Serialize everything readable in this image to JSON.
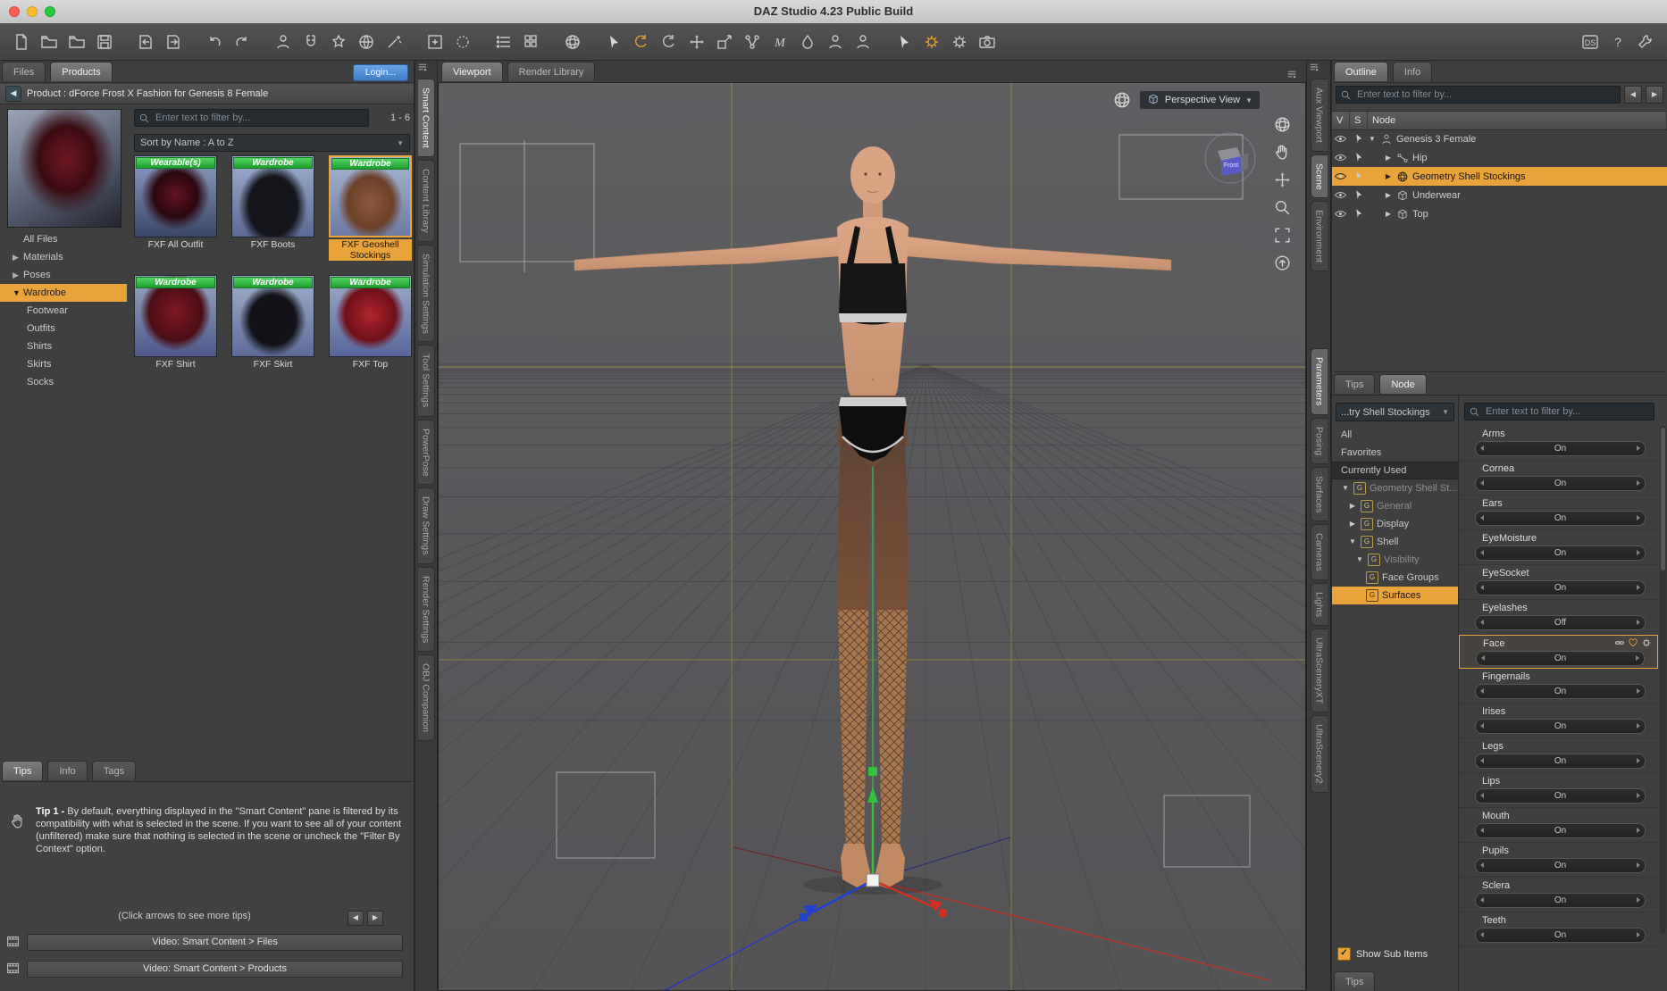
{
  "window": {
    "title": "DAZ Studio 4.23 Public Build"
  },
  "colors": {
    "accent_orange": "#E8A33B",
    "badge_green": "#2FB441",
    "login_blue": "#4D8FD6",
    "guide_yellow": "#B5A52A",
    "axis_red": "#C03028",
    "axis_green": "#35C040",
    "axis_blue": "#2840C8"
  },
  "toolbar": {
    "icons": [
      "new-file",
      "open-file",
      "merge-file",
      "save-file",
      "import",
      "export",
      "undo",
      "redo",
      "create-new-node",
      "magnet-snap",
      "align-tool",
      "perspective-gizmo",
      "magic-wand",
      "add-plane",
      "selection-marquee",
      "list-view",
      "thumbnail-grid-view",
      "iray-preview-sphere",
      "node-selection-tool",
      "rotate-tool",
      "orbit-tool",
      "translate-tool",
      "scale-tool",
      "node-connector-tool",
      "weight-map-tool",
      "geometry-editor-tool",
      "figure-transform-tool",
      "figure-setup-tool",
      "pointer-add-tool",
      "render-settings",
      "preferences",
      "spot-render-camera",
      "daz-store",
      "help",
      "customize"
    ]
  },
  "smart_content": {
    "tabs": {
      "files": "Files",
      "products": "Products"
    },
    "login": "Login...",
    "breadcrumb": "Product : dForce Frost X Fashion for Genesis 8 Female",
    "filter_placeholder": "Enter text to filter by...",
    "range": "1 - 6",
    "sort": "Sort by Name : A to Z",
    "categories": {
      "all_files": "All Files",
      "materials": "Materials",
      "poses": "Poses",
      "wardrobe": "Wardrobe",
      "footwear": "Footwear",
      "outfits": "Outfits",
      "shirts": "Shirts",
      "skirts": "Skirts",
      "socks": "Socks"
    },
    "products": [
      {
        "badge": "Wearable(s)",
        "name": "FXF All Outfit"
      },
      {
        "badge": "Wardrobe",
        "name": "FXF Boots"
      },
      {
        "badge": "Wardrobe",
        "name": "FXF Geoshell Stockings"
      },
      {
        "badge": "Wardrobe",
        "name": "FXF Shirt"
      },
      {
        "badge": "Wardrobe",
        "name": "FXF Skirt"
      },
      {
        "badge": "Wardrobe",
        "name": "FXF Top"
      }
    ],
    "tips": {
      "tabs": {
        "tips": "Tips",
        "info": "Info",
        "tags": "Tags"
      },
      "tip_label": "Tip 1 -",
      "tip_text": " By default, everything displayed in the \"Smart Content\" pane is filtered by its compatibility with what is selected in the scene. If you want to see all of your content (unfiltered) make sure that nothing is selected in the scene or uncheck the \"Filter By Context\" option.",
      "nav_hint": "(Click arrows to see more tips)",
      "video_files": "Video: Smart Content > Files",
      "video_products": "Video: Smart Content > Products"
    }
  },
  "left_tabs": [
    "Smart Content",
    "Content Library",
    "Simulation Settings",
    "Tool Settings",
    "PowerPose",
    "Draw Settings",
    "Render Settings",
    "OBJ Companion"
  ],
  "viewport": {
    "tab_viewport": "Viewport",
    "tab_render_library": "Render Library",
    "camera": "Perspective View",
    "cube_label": "Front",
    "side_tools": [
      "lighting-sphere",
      "pan-hand",
      "dolly-move",
      "zoom-magnifier",
      "aspect-frame",
      "reset-view"
    ]
  },
  "right_tabs": {
    "aux": "Aux Viewport",
    "scene": "Scene",
    "environment": "Environment",
    "parameters": "Parameters",
    "posing": "Posing",
    "surfaces": "Surfaces",
    "cameras": "Cameras",
    "lights": "Lights",
    "ultraxt": "UltraSceneryXT",
    "ultra2": "UltraScenery2"
  },
  "scene_pane": {
    "tab_outline": "Outline",
    "tab_info": "Info",
    "filter_placeholder": "Enter text to filter by...",
    "col_v": "V",
    "col_s": "S",
    "col_node": "Node",
    "nodes": [
      {
        "label": "Genesis 3 Female"
      },
      {
        "label": "Hip"
      },
      {
        "label": "Geometry Shell Stockings"
      },
      {
        "label": "Underwear"
      },
      {
        "label": "Top"
      }
    ],
    "tab_tips": "Tips",
    "tab_node": "Node"
  },
  "parameters_pane": {
    "preset": "...try Shell Stockings",
    "filter_placeholder": "Enter text to filter by...",
    "list_all": "All",
    "list_favorites": "Favorites",
    "list_current": "Currently Used",
    "tree": [
      {
        "label": "Geometry Shell St..."
      },
      {
        "label": "General"
      },
      {
        "label": "Display"
      },
      {
        "label": "Shell"
      },
      {
        "label": "Visibility"
      },
      {
        "label": "Face Groups"
      },
      {
        "label": "Surfaces"
      }
    ],
    "params": [
      {
        "name": "Arms",
        "state": "On"
      },
      {
        "name": "Cornea",
        "state": "On"
      },
      {
        "name": "Ears",
        "state": "On"
      },
      {
        "name": "EyeMoisture",
        "state": "On"
      },
      {
        "name": "EyeSocket",
        "state": "On"
      },
      {
        "name": "Eyelashes",
        "state": "Off"
      },
      {
        "name": "Face",
        "state": "On"
      },
      {
        "name": "Fingernails",
        "state": "On"
      },
      {
        "name": "Irises",
        "state": "On"
      },
      {
        "name": "Legs",
        "state": "On"
      },
      {
        "name": "Lips",
        "state": "On"
      },
      {
        "name": "Mouth",
        "state": "On"
      },
      {
        "name": "Pupils",
        "state": "On"
      },
      {
        "name": "Sclera",
        "state": "On"
      },
      {
        "name": "Teeth",
        "state": "On"
      }
    ],
    "show_sub_items": "Show Sub Items",
    "tab_tips": "Tips"
  }
}
